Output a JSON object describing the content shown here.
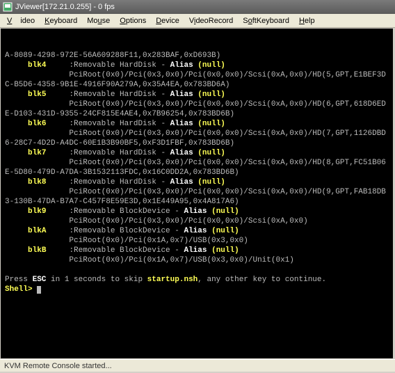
{
  "window": {
    "title": "JViewer[172.21.0.255] - 0 fps"
  },
  "menu": [
    "Video",
    "Keyboard",
    "Mouse",
    "Options",
    "Device",
    "VideoRecord",
    "SoftKeyboard",
    "Help"
  ],
  "line0": "A-8089-4298-972E-56A609288F11,0x283BAF,0xD693B)",
  "blocks": [
    {
      "name": "blk4",
      "label": ":Removable HardDisk - ",
      "alias": "Alias",
      "nullw": "(null)",
      "path": "PciRoot(0x0)/Pci(0x3,0x0)/Pci(0x0,0x0)/Scsi(0xA,0x0)/HD(5,GPT,E1BEF3D",
      "cont": "C-B5D6-4358-9B1E-4916F90A279A,0x35A4EA,0x783BD6A)"
    },
    {
      "name": "blk5",
      "label": ":Removable HardDisk - ",
      "alias": "Alias",
      "nullw": "(null)",
      "path": "PciRoot(0x0)/Pci(0x3,0x0)/Pci(0x0,0x0)/Scsi(0xA,0x0)/HD(6,GPT,618D6ED",
      "cont": "E-D103-431D-9355-24CF815E4AE4,0x7B96254,0x783BD6B)"
    },
    {
      "name": "blk6",
      "label": ":Removable HardDisk - ",
      "alias": "Alias",
      "nullw": "(null)",
      "path": "PciRoot(0x0)/Pci(0x3,0x0)/Pci(0x0,0x0)/Scsi(0xA,0x0)/HD(7,GPT,1126DBD",
      "cont": "6-28C7-4D2D-A4DC-60E1B3B90BF5,0xF3D1FBF,0x783BD6B)"
    },
    {
      "name": "blk7",
      "label": ":Removable HardDisk - ",
      "alias": "Alias",
      "nullw": "(null)",
      "path": "PciRoot(0x0)/Pci(0x3,0x0)/Pci(0x0,0x0)/Scsi(0xA,0x0)/HD(8,GPT,FC51B06",
      "cont": "E-5D80-479D-A7DA-3B1532113FDC,0x16C0DD2A,0x783BD6B)"
    },
    {
      "name": "blk8",
      "label": ":Removable HardDisk - ",
      "alias": "Alias",
      "nullw": "(null)",
      "path": "PciRoot(0x0)/Pci(0x3,0x0)/Pci(0x0,0x0)/Scsi(0xA,0x0)/HD(9,GPT,FAB18DB",
      "cont": "3-130B-47DA-B7A7-C457F8E59E3D,0x1E449A95,0x4A817A6)"
    },
    {
      "name": "blk9",
      "label": ":Removable BlockDevice - ",
      "alias": "Alias",
      "nullw": "(null)",
      "path": "PciRoot(0x0)/Pci(0x3,0x0)/Pci(0x0,0x0)/Scsi(0xA,0x0)",
      "cont": ""
    },
    {
      "name": "blkA",
      "label": ":Removable BlockDevice - ",
      "alias": "Alias",
      "nullw": "(null)",
      "path": "PciRoot(0x0)/Pci(0x1A,0x7)/USB(0x3,0x0)",
      "cont": ""
    },
    {
      "name": "blkB",
      "label": ":Removable BlockDevice - ",
      "alias": "Alias",
      "nullw": "(null)",
      "path": "PciRoot(0x0)/Pci(0x1A,0x7)/USB(0x3,0x0)/Unit(0x1)",
      "cont": ""
    }
  ],
  "footer": {
    "press": "Press ",
    "esc": "ESC",
    "mid": " in 1 seconds to skip ",
    "startup": "startup.nsh",
    "tail": ", any other key to continue.",
    "prompt": "Shell> "
  },
  "status": "KVM Remote Console started..."
}
